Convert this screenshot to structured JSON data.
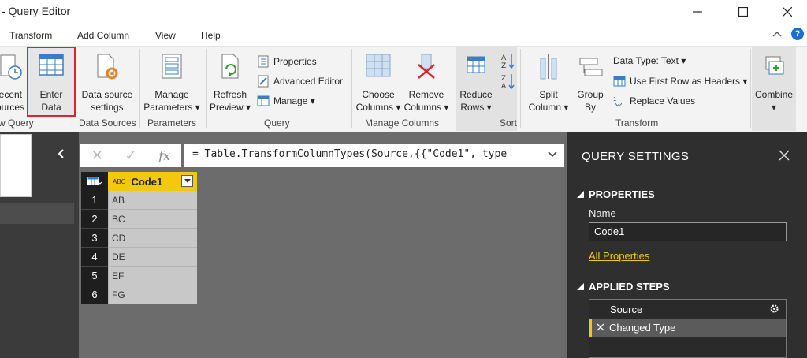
{
  "window": {
    "title": "- Query Editor"
  },
  "menu": {
    "tabs": [
      "Transform",
      "Add Column",
      "View",
      "Help"
    ],
    "help": "?"
  },
  "ribbon": {
    "recent_sources": "Recent\nSources",
    "enter_data": "Enter\nData",
    "data_source_settings": "Data source\nsettings",
    "manage_parameters": "Manage\nParameters ▾",
    "refresh_preview": "Refresh\nPreview ▾",
    "properties": "Properties",
    "advanced_editor": "Advanced Editor",
    "manage": "Manage ▾",
    "choose_columns": "Choose\nColumns ▾",
    "remove_columns": "Remove\nColumns ▾",
    "reduce_rows": "Reduce\nRows ▾",
    "split_column": "Split\nColumn ▾",
    "group_by": "Group\nBy",
    "data_type": "Data Type: Text ▾",
    "first_row_headers": "Use First Row as Headers ▾",
    "replace_values": "Replace Values",
    "combine": "Combine\n▾",
    "groups": {
      "new_query": "w Query",
      "data_sources": "Data Sources",
      "parameters": "Parameters",
      "query": "Query",
      "manage_columns": "Manage Columns",
      "sort": "Sort",
      "transform": "Transform"
    }
  },
  "formula_bar": {
    "cancel": "✕",
    "commit": "✓",
    "fx": "fx",
    "expression": "= Table.TransformColumnTypes(Source,{{\"Code1\", type"
  },
  "grid": {
    "column_type": "ABC",
    "column_name": "Code1",
    "rows": [
      {
        "n": "1",
        "v": "AB"
      },
      {
        "n": "2",
        "v": "BC"
      },
      {
        "n": "3",
        "v": "CD"
      },
      {
        "n": "4",
        "v": "DE"
      },
      {
        "n": "5",
        "v": "EF"
      },
      {
        "n": "6",
        "v": "FG"
      }
    ]
  },
  "query_settings": {
    "title": "QUERY SETTINGS",
    "properties_header": "PROPERTIES",
    "name_label": "Name",
    "name_value": "Code1",
    "all_properties": "All Properties",
    "applied_steps_header": "APPLIED STEPS",
    "steps": [
      "Source",
      "Changed Type"
    ]
  },
  "colors": {
    "accent": "#f2c811",
    "highlight": "#d9262e",
    "pane": "#2f2f2f"
  }
}
